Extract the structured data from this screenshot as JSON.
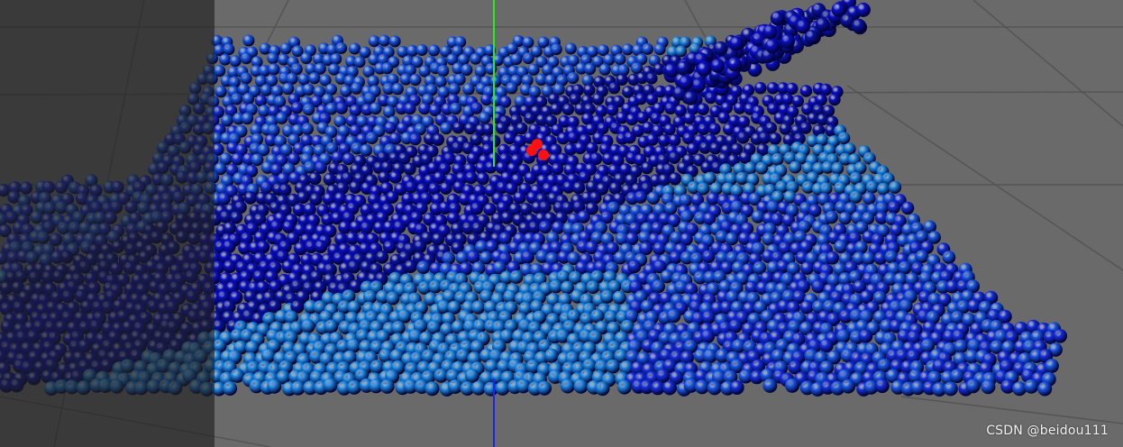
{
  "viewport": {
    "background_color": "#6a6a6a",
    "grid_color": "#555555",
    "overlay_color": "#202020"
  },
  "particles": {
    "palette": [
      "#0a10c8",
      "#1530e0",
      "#1a5ae8",
      "#1f8ae6",
      "#0a14a8"
    ],
    "highlight_color": "#ff1010"
  },
  "axes": {
    "z_axis_color": "#22ee22",
    "neg_z_color": "#2222ee"
  },
  "watermark": {
    "text": "CSDN @beidou111"
  }
}
